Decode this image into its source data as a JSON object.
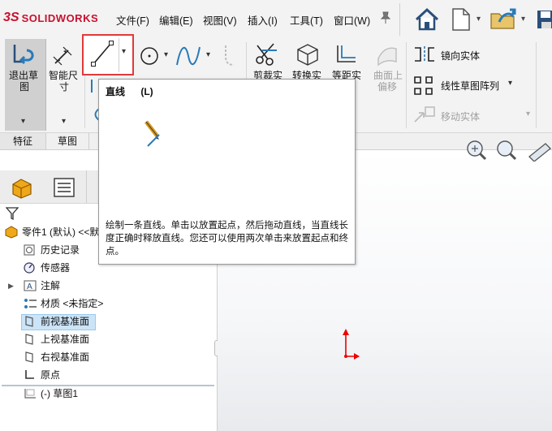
{
  "app": {
    "logo_ds": "3S",
    "logo_text": "SOLIDWORKS"
  },
  "menu": [
    "文件(F)",
    "编辑(E)",
    "视图(V)",
    "插入(I)",
    "工具(T)",
    "窗口(W)"
  ],
  "ribbon": {
    "exit_sketch": [
      "退出草",
      "图"
    ],
    "smart_dim": [
      "智能尺",
      "寸"
    ],
    "trim": "剪裁实",
    "convert": "转换实",
    "offset": "等距实",
    "surface_offset": [
      "曲面上",
      "偏移"
    ],
    "mirror": "镜向实体",
    "linear_pattern": "线性草图阵列",
    "move": "移动实体"
  },
  "tabs": [
    "特征",
    "草图"
  ],
  "tooltip": {
    "title": "直线",
    "shortcut": "(L)",
    "description": "绘制一条直线。单击以放置起点，然后拖动直线，当直线长度正确时释放直线。您还可以使用两次单击来放置起点和终点。"
  },
  "tree": {
    "root": "零件1 (默认) <<默",
    "items": [
      "历史记录",
      "传感器",
      "注解",
      "材质 <未指定>",
      "前视基准面",
      "上视基准面",
      "右视基准面",
      "原点",
      "(-) 草图1"
    ]
  },
  "colors": {
    "accent": "#2a7ab8",
    "highlight": "#e03a3a",
    "selected_bg": "#cce4f7"
  }
}
